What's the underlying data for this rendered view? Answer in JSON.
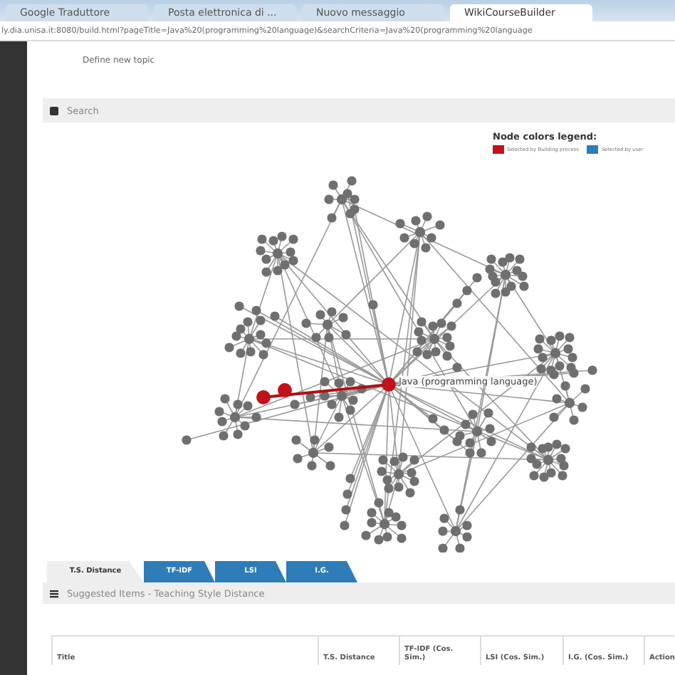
{
  "browser_tabs": [
    {
      "title": "Google Traduttore",
      "selected": false
    },
    {
      "title": "Posta elettronica di ...",
      "selected": false
    },
    {
      "title": "Nuovo messaggio",
      "selected": false
    },
    {
      "title": "WikiCourseBuilder",
      "selected": true
    }
  ],
  "address_bar": {
    "url": "ly.dia.unisa.it:8080/build.html?pageTitle=Java%20(programming%20language)&searchCriteria=Java%20(programming%20language"
  },
  "top_link": "Define new topic",
  "search_panel": {
    "title": "Search"
  },
  "legend": {
    "title": "Node colors legend:",
    "items": [
      {
        "label": "Selected by Building process",
        "color": "#c0121b"
      },
      {
        "label": "Selected by user",
        "color": "#2e7db8"
      }
    ]
  },
  "graph": {
    "node_label": "Java (programming language)"
  },
  "result_tabs": [
    {
      "label": "T.S. Distance",
      "selected": true
    },
    {
      "label": "TF-IDF",
      "selected": false
    },
    {
      "label": "LSI",
      "selected": false
    },
    {
      "label": "I.G.",
      "selected": false
    }
  ],
  "list_panel": {
    "title": "Suggested Items - Teaching Style Distance"
  },
  "table": {
    "columns": [
      "Title",
      "T.S. Distance",
      "TF-IDF (Cos. Sim.)",
      "LSI (Cos. Sim.)",
      "I.G. (Cos. Sim.)",
      "Action"
    ]
  }
}
